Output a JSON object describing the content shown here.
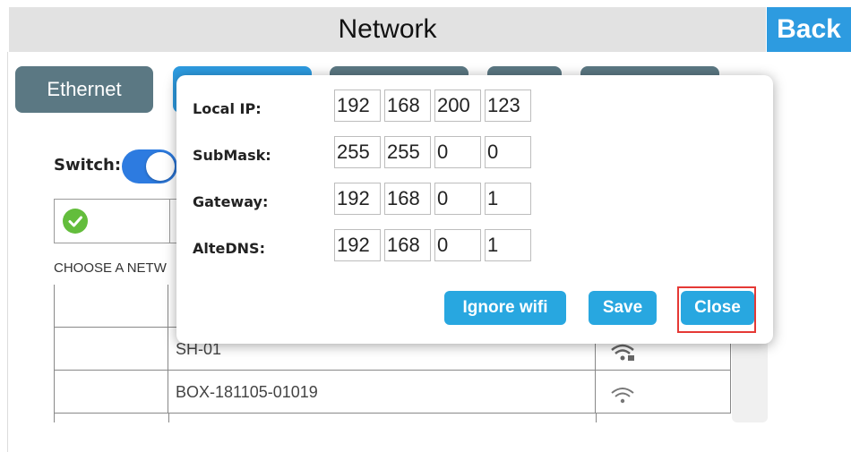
{
  "header": {
    "title": "Network",
    "back_label": "Back"
  },
  "tabs": [
    {
      "label": "Ethernet",
      "active": false
    },
    {
      "label": "",
      "active": true
    },
    {
      "label": "",
      "active": false
    },
    {
      "label": "",
      "active": false
    },
    {
      "label": "",
      "active": false
    }
  ],
  "wifi": {
    "switch_label": "Switch:",
    "switch_on": true,
    "status_icon": "check-circle-icon",
    "choose_label": "CHOOSE A NETW",
    "networks": [
      {
        "name": "",
        "signal_icon": "wifi-icon"
      },
      {
        "name": "SH-01",
        "signal_icon": "wifi-icon"
      },
      {
        "name": "BOX-181105-01019",
        "signal_icon": "wifi-icon"
      }
    ]
  },
  "dialog": {
    "fields": [
      {
        "label": "Local IP:",
        "octets": [
          "192",
          "168",
          "200",
          "123"
        ]
      },
      {
        "label": "SubMask:",
        "octets": [
          "255",
          "255",
          "0",
          "0"
        ]
      },
      {
        "label": "Gateway:",
        "octets": [
          "192",
          "168",
          "0",
          "1"
        ]
      },
      {
        "label": "AlteDNS:",
        "octets": [
          "192",
          "168",
          "0",
          "1"
        ]
      }
    ],
    "buttons": {
      "ignore": "Ignore wifi",
      "save": "Save",
      "close": "Close"
    }
  },
  "colors": {
    "accent_blue": "#2d9be0",
    "tab_gray": "#5b7883",
    "ok_green": "#63bd3c",
    "highlight_red": "#e53935"
  }
}
